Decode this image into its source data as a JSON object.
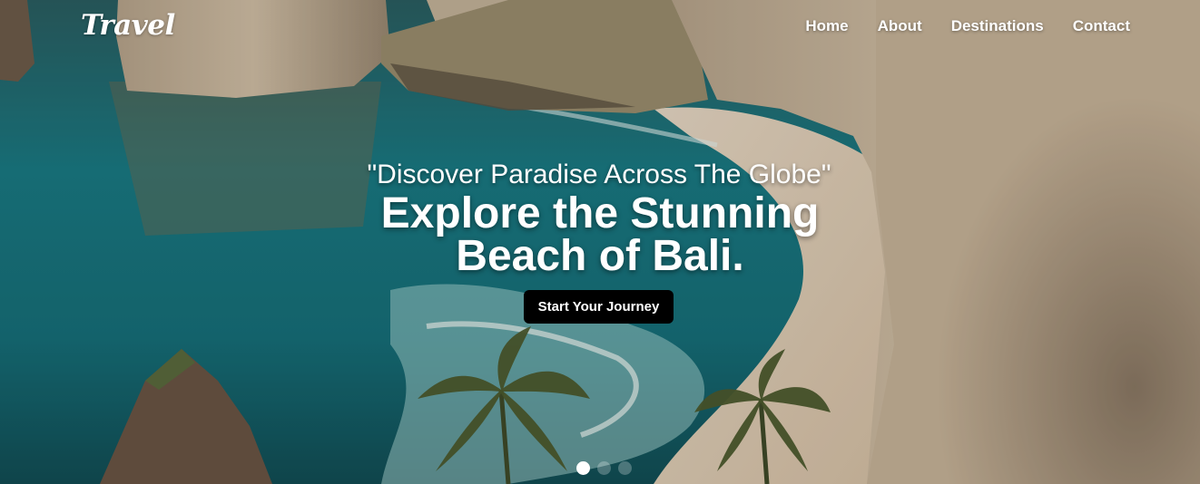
{
  "brand": {
    "logo": "Travel"
  },
  "nav": {
    "items": [
      "Home",
      "About",
      "Destinations",
      "Contact"
    ]
  },
  "hero": {
    "tagline": "\"Discover Paradise Across The Globe\"",
    "headline": "Explore the Stunning Beach of Bali.",
    "cta_label": "Start Your Journey"
  },
  "carousel": {
    "slide_count": 3,
    "active_index": 0
  },
  "colors": {
    "text": "#ffffff",
    "cta_background": "#000000",
    "sea": "#1b7c86",
    "cliff": "#cbb79c",
    "sand": "#e8d6c0"
  }
}
